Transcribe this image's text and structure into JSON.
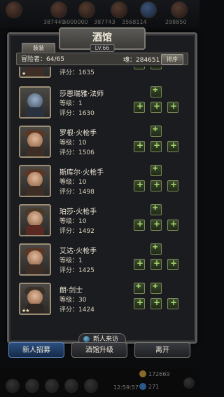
{
  "hud": {
    "top_text_1": "387449",
    "top_text_2": "5000000",
    "top_text_3": "387743",
    "top_text_4": "3568114",
    "top_text_5": "298850"
  },
  "panel": {
    "title": "酒馆",
    "level_badge": "LV.66",
    "tab": "装装",
    "adventurers_label": "冒险者：64/65",
    "coins_label": "魂：284651",
    "sort_button": "排序"
  },
  "heroes": [
    {
      "name": "",
      "level": "",
      "score": "评分：1635",
      "stars": "★"
    },
    {
      "name": "莎恩瑞雅·法师",
      "level": "等级：1",
      "score": "评分：1630",
      "stars": ""
    },
    {
      "name": "罗根·火枪手",
      "level": "等级：10",
      "score": "评分：1506",
      "stars": ""
    },
    {
      "name": "斯库尔·火枪手",
      "level": "等级：10",
      "score": "评分：1498",
      "stars": ""
    },
    {
      "name": "珀莎·火枪手",
      "level": "等级：10",
      "score": "评分：1492",
      "stars": ""
    },
    {
      "name": "艾达·火枪手",
      "level": "等级：1",
      "score": "评分：1425",
      "stars": ""
    },
    {
      "name": "朗·剑士",
      "level": "等级：30",
      "score": "评分：1424",
      "stars": "★★"
    }
  ],
  "new_arrival": "新人来访",
  "buttons": {
    "recruit": "新人招募",
    "upgrade": "酒馆升级",
    "leave": "离开"
  },
  "bottom": {
    "clock": "12:59:57",
    "res_1": "172669",
    "res_2": "271"
  }
}
